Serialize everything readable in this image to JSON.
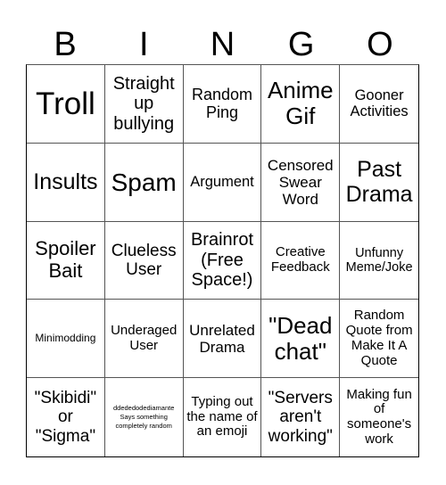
{
  "header": {
    "letters": [
      "B",
      "I",
      "N",
      "G",
      "O"
    ]
  },
  "cells": [
    "Troll",
    "Straight up bullying",
    "Random Ping",
    "Anime Gif",
    "Gooner Activities",
    "Insults",
    "Spam",
    "Argument",
    "Censored Swear Word",
    "Past Drama",
    "Spoiler Bait",
    "Clueless User",
    "Brainrot (Free Space!)",
    "Creative Feedback",
    "Unfunny Meme/Joke",
    "Minimodding",
    "Underaged User",
    "Unrelated Drama",
    "\"Dead chat\"",
    "Random Quote from Make It A Quote",
    "\"Skibidi\" or \"Sigma\"",
    "ddededodediamante Says something completely random",
    "Typing out the name of an emoji",
    "\"Servers aren't working\"",
    "Making fun of someone's work"
  ]
}
